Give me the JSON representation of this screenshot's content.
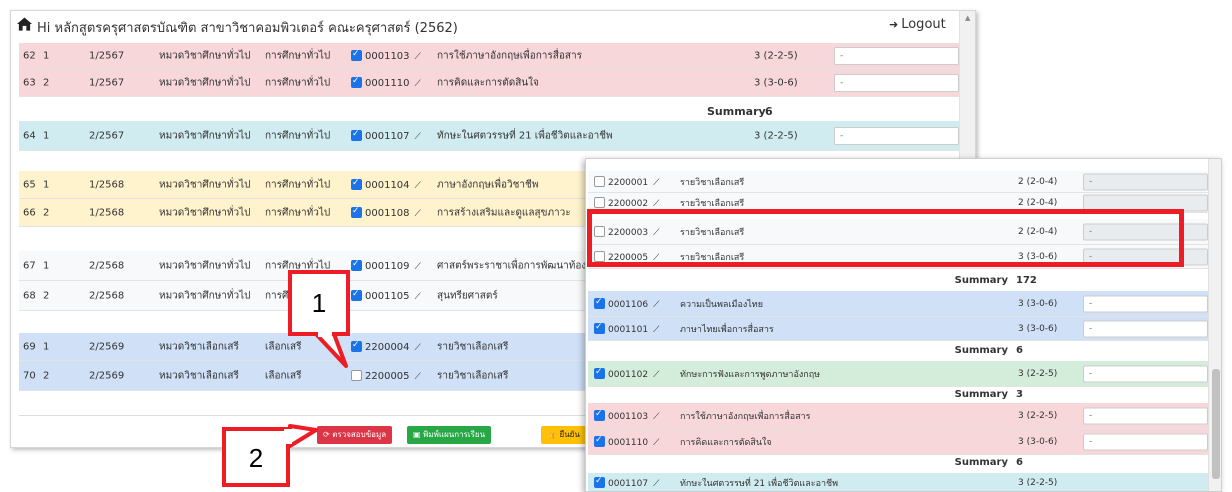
{
  "header": {
    "title": "Hi หลักสูตรครุศาสตรบัณฑิต สาขาวิชาคอมพิวเตอร์ คณะครุศาสตร์ (2562)",
    "logout": "Logout"
  },
  "rows": [
    {
      "no": "62",
      "seq": "1",
      "term": "1/2567",
      "group": "หมวดวิชาศึกษาทั่วไป",
      "category": "การศึกษาทั่วไป",
      "code": "0001103",
      "checked": true,
      "name": "การใช้ภาษาอังกฤษเพื่อการสื่อสาร",
      "credit": "3 (2-2-5)",
      "input": "-",
      "color": "pink"
    },
    {
      "no": "63",
      "seq": "2",
      "term": "1/2567",
      "group": "หมวดวิชาศึกษาทั่วไป",
      "category": "การศึกษาทั่วไป",
      "code": "0001110",
      "checked": true,
      "name": "การคิดและการตัดสินใจ",
      "credit": "3 (3-0-6)",
      "input": "-",
      "color": "pink"
    },
    {
      "no": "64",
      "seq": "1",
      "term": "2/2567",
      "group": "หมวดวิชาศึกษาทั่วไป",
      "category": "การศึกษาทั่วไป",
      "code": "0001107",
      "checked": true,
      "name": "ทักษะในศตวรรษที่ 21 เพื่อชีวิตและอาชีพ",
      "credit": "3 (2-2-5)",
      "input": "-",
      "color": "cyan"
    },
    {
      "no": "65",
      "seq": "1",
      "term": "1/2568",
      "group": "หมวดวิชาศึกษาทั่วไป",
      "category": "การศึกษาทั่วไป",
      "code": "0001104",
      "checked": true,
      "name": "ภาษาอังกฤษเพื่อวิชาชีพ",
      "credit": "",
      "input": "",
      "color": "yellow"
    },
    {
      "no": "66",
      "seq": "2",
      "term": "1/2568",
      "group": "หมวดวิชาศึกษาทั่วไป",
      "category": "การศึกษาทั่วไป",
      "code": "0001108",
      "checked": true,
      "name": "การสร้างเสริมและดูแลสุขภาวะ",
      "credit": "",
      "input": "",
      "color": "yellow"
    },
    {
      "no": "67",
      "seq": "1",
      "term": "2/2568",
      "group": "หมวดวิชาศึกษาทั่วไป",
      "category": "การศึกษาทั่วไป",
      "code": "0001109",
      "checked": true,
      "name": "ศาสตร์พระราชาเพื่อการพัฒนาท้องถิ่น",
      "credit": "",
      "input": "",
      "color": "plain"
    },
    {
      "no": "68",
      "seq": "2",
      "term": "2/2568",
      "group": "หมวดวิชาศึกษาทั่วไป",
      "category": "การศึกษาทั่วไป",
      "code": "0001105",
      "checked": true,
      "name": "สุนทรียศาสตร์",
      "credit": "",
      "input": "",
      "color": "plain"
    },
    {
      "no": "69",
      "seq": "1",
      "term": "2/2569",
      "group": "หมวดวิชาเลือกเสรี",
      "category": "เลือกเสรี",
      "code": "2200004",
      "checked": true,
      "name": "รายวิชาเลือกเสรี",
      "credit": "",
      "input": "",
      "color": "blue"
    },
    {
      "no": "70",
      "seq": "2",
      "term": "2/2569",
      "group": "หมวดวิชาเลือกเสรี",
      "category": "เลือกเสรี",
      "code": "2200005",
      "checked": false,
      "name": "รายวิชาเลือกเสรี",
      "credit": "",
      "input": "",
      "color": "blue"
    }
  ],
  "summary": {
    "label": "Summary",
    "value": "6"
  },
  "buttons": {
    "verify": "ตรวจสอบข้อมูล",
    "print": "พิมพ์แผนการเรียน",
    "confirm": "ยืนยัน"
  },
  "overlay": {
    "rows": [
      {
        "code": "2200001",
        "checked": false,
        "name": "รายวิชาเลือกเสรี",
        "credit": "2 (2-0-4)",
        "input": "-",
        "disabled": true,
        "color": "plain"
      },
      {
        "code": "2200002",
        "checked": false,
        "name": "รายวิชาเลือกเสรี",
        "credit": "2 (2-0-4)",
        "input": "",
        "disabled": true,
        "color": "plain"
      },
      {
        "code": "2200003",
        "checked": false,
        "name": "รายวิชาเลือกเสรี",
        "credit": "2 (2-0-4)",
        "input": "-",
        "disabled": true,
        "color": "plain"
      },
      {
        "code": "2200005",
        "checked": false,
        "name": "รายวิชาเลือกเสรี",
        "credit": "3 (3-0-6)",
        "input": "-",
        "disabled": true,
        "color": "plain"
      },
      {
        "code": "0001106",
        "checked": true,
        "name": "ความเป็นพลเมืองไทย",
        "credit": "3 (3-0-6)",
        "input": "-",
        "disabled": false,
        "color": "blue"
      },
      {
        "code": "0001101",
        "checked": true,
        "name": "ภาษาไทยเพื่อการสื่อสาร",
        "credit": "3 (3-0-6)",
        "input": "-",
        "disabled": false,
        "color": "blue"
      },
      {
        "code": "0001102",
        "checked": true,
        "name": "ทักษะการฟังและการพูดภาษาอังกฤษ",
        "credit": "3 (2-2-5)",
        "input": "-",
        "disabled": false,
        "color": "green"
      },
      {
        "code": "0001103",
        "checked": true,
        "name": "การใช้ภาษาอังกฤษเพื่อการสื่อสาร",
        "credit": "3 (2-2-5)",
        "input": "-",
        "disabled": false,
        "color": "pink"
      },
      {
        "code": "0001110",
        "checked": true,
        "name": "การคิดและการตัดสินใจ",
        "credit": "3 (3-0-6)",
        "input": "-",
        "disabled": false,
        "color": "pink"
      },
      {
        "code": "0001107",
        "checked": true,
        "name": "ทักษะในศตวรรษที่ 21 เพื่อชีวิตและอาชีพ",
        "credit": "3 (2-2-5)",
        "input": "",
        "disabled": false,
        "color": "cyan"
      }
    ],
    "summaries": [
      {
        "label": "Summary",
        "value": "172"
      },
      {
        "label": "Summary",
        "value": "6"
      },
      {
        "label": "Summary",
        "value": "3"
      },
      {
        "label": "Summary",
        "value": "6"
      }
    ]
  },
  "callouts": {
    "one": "1",
    "two": "2"
  },
  "colors": {
    "annotation": "#ee1c24",
    "pink": "#f8d7da",
    "cyan": "#d1ecf1",
    "yellow": "#fff3cd",
    "blue": "#cfe0f7",
    "green": "#d4edda"
  }
}
